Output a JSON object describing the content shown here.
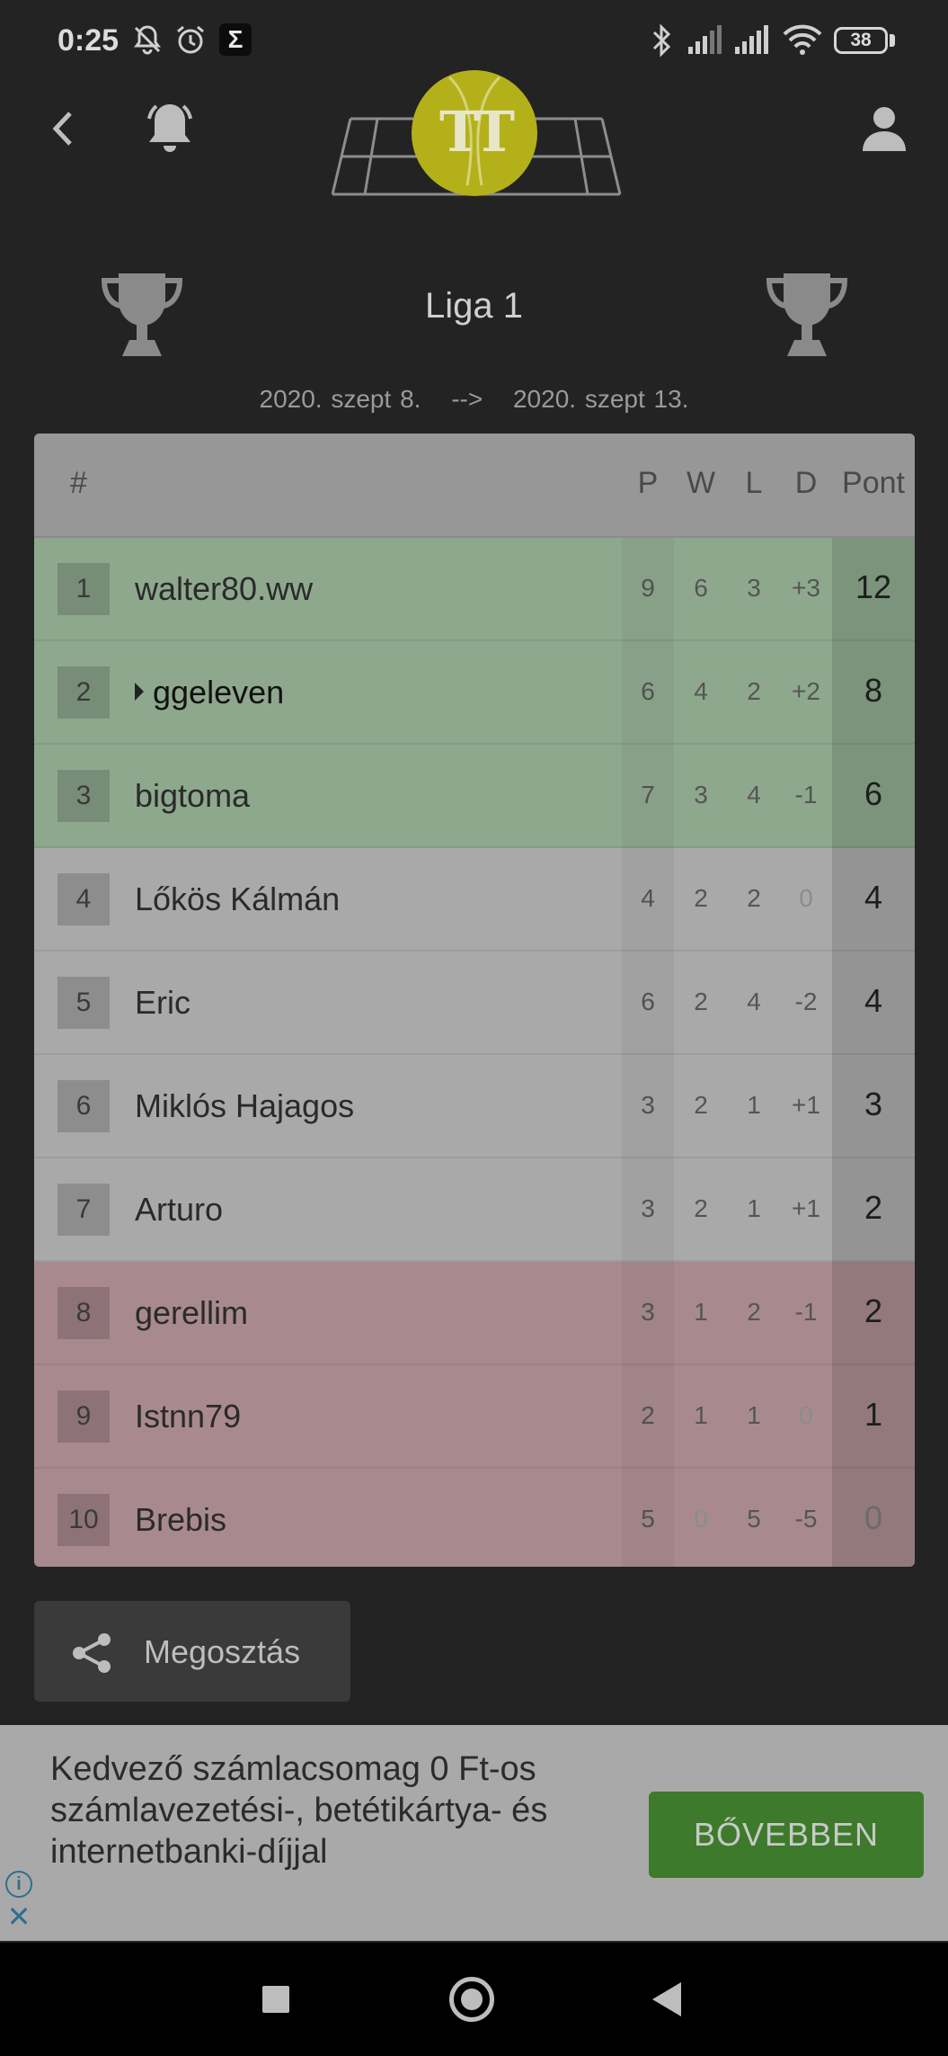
{
  "status_bar": {
    "time": "0:25",
    "icons": [
      "bell-off-icon",
      "alarm-icon",
      "sigma-icon",
      "bluetooth-icon",
      "signal-icon",
      "signal-icon",
      "wifi-icon",
      "battery-icon"
    ],
    "battery_level": "38"
  },
  "header": {
    "logo_text": "TT",
    "icons": [
      "back-arrow-icon",
      "bell-icon",
      "tennis-ball-logo",
      "user-icon"
    ]
  },
  "league": {
    "title": "Liga 1",
    "date_start": "2020. szept 8.",
    "arrow": "-->",
    "date_end": "2020. szept 13."
  },
  "table": {
    "columns": [
      "#",
      "P",
      "W",
      "L",
      "D",
      "Pont"
    ],
    "rows": [
      {
        "rank": "1",
        "name": "walter80.ww",
        "p": "9",
        "w": "6",
        "l": "3",
        "d": "+3",
        "pont": "12",
        "zone": "promotion"
      },
      {
        "rank": "2",
        "name": "ggeleven",
        "p": "6",
        "w": "4",
        "l": "2",
        "d": "+2",
        "pont": "8",
        "zone": "promotion",
        "current_user": true
      },
      {
        "rank": "3",
        "name": "bigtoma",
        "p": "7",
        "w": "3",
        "l": "4",
        "d": "-1",
        "pont": "6",
        "zone": "promotion"
      },
      {
        "rank": "4",
        "name": "Lőkös Kálmán",
        "p": "4",
        "w": "2",
        "l": "2",
        "d": "0",
        "pont": "4",
        "zone": "neutral"
      },
      {
        "rank": "5",
        "name": "Eric",
        "p": "6",
        "w": "2",
        "l": "4",
        "d": "-2",
        "pont": "4",
        "zone": "neutral"
      },
      {
        "rank": "6",
        "name": "Miklós Hajagos",
        "p": "3",
        "w": "2",
        "l": "1",
        "d": "+1",
        "pont": "3",
        "zone": "neutral"
      },
      {
        "rank": "7",
        "name": "Arturo",
        "p": "3",
        "w": "2",
        "l": "1",
        "d": "+1",
        "pont": "2",
        "zone": "neutral"
      },
      {
        "rank": "8",
        "name": "gerellim",
        "p": "3",
        "w": "1",
        "l": "2",
        "d": "-1",
        "pont": "2",
        "zone": "relegation"
      },
      {
        "rank": "9",
        "name": "Istnn79",
        "p": "2",
        "w": "1",
        "l": "1",
        "d": "0",
        "pont": "1",
        "zone": "relegation"
      },
      {
        "rank": "10",
        "name": "Brebis",
        "p": "5",
        "w": "0",
        "l": "5",
        "d": "-5",
        "pont": "0",
        "zone": "relegation"
      }
    ]
  },
  "share": {
    "label": "Megosztás",
    "icon": "share-icon"
  },
  "ad": {
    "text": "Kedvező számlacsomag 0 Ft-os számlavezetési-, betétikártya- és internetbanki-díjjal",
    "button_label": "BŐVEBBEN",
    "button_color": "#3d7a2b",
    "info_glyph": "i",
    "close_glyph": "✕"
  },
  "colors": {
    "promotion_row": "#8ea88e",
    "neutral_row": "#a9a9a9",
    "relegation_row": "#a88a8e",
    "background": "#232323"
  }
}
